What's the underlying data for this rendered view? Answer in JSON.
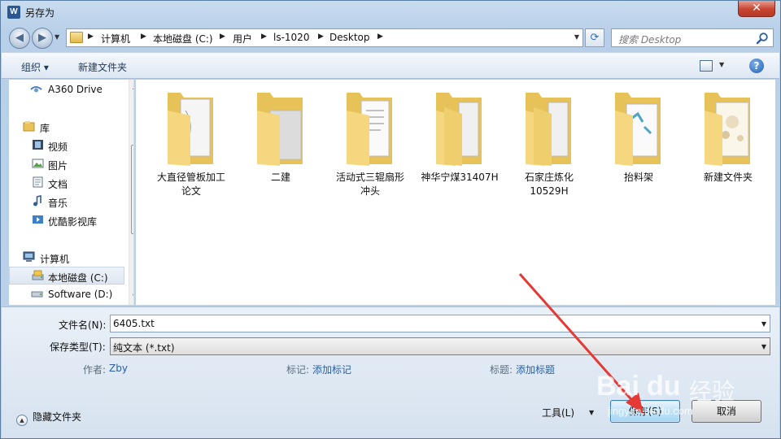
{
  "window": {
    "title": "另存为",
    "app_icon_letter": "W",
    "close_symbol": "✕"
  },
  "address": {
    "crumbs": [
      "计算机",
      "本地磁盘 (C:)",
      "用户",
      "ls-1020",
      "Desktop"
    ],
    "search_placeholder": "搜索 Desktop"
  },
  "toolbar": {
    "organize_label": "组织 ▾",
    "new_folder_label": "新建文件夹"
  },
  "navpane": {
    "items": [
      {
        "label": "A360 Drive",
        "icon": "a360-drive-icon"
      },
      {
        "label": "库",
        "icon": "library-icon"
      },
      {
        "label": "视频",
        "icon": "videos-icon"
      },
      {
        "label": "图片",
        "icon": "pictures-icon"
      },
      {
        "label": "文档",
        "icon": "documents-icon"
      },
      {
        "label": "音乐",
        "icon": "music-icon"
      },
      {
        "label": "优酷影视库",
        "icon": "youku-library-icon"
      },
      {
        "label": "计算机",
        "icon": "computer-icon"
      },
      {
        "label": "本地磁盘 (C:)",
        "icon": "local-disk-icon"
      },
      {
        "label": "Software (D:)",
        "icon": "drive-icon"
      }
    ],
    "selected": "本地磁盘 (C:)"
  },
  "files": [
    {
      "name": "大直径管板加工\n论文"
    },
    {
      "name": "二建"
    },
    {
      "name": "活动式三辊扇形\n冲头"
    },
    {
      "name": "神华宁煤31407H"
    },
    {
      "name": "石家庄炼化\n10529H"
    },
    {
      "name": "抬料架"
    },
    {
      "name": "新建文件夹"
    }
  ],
  "form": {
    "filename_label": "文件名(N):",
    "filename_value": "6405.txt",
    "filetype_label": "保存类型(T):",
    "filetype_value": "纯文本 (*.txt)",
    "author_label": "作者:",
    "author_value": "Zby",
    "tags_label": "标记:",
    "tags_value": "添加标记",
    "title_label": "标题:",
    "title_value": "添加标题"
  },
  "footer": {
    "hide_folders_label": "隐藏文件夹",
    "tools_label": "工具(L)",
    "save_label": "保存(S)",
    "cancel_label": "取消"
  },
  "watermark": {
    "brand": "Bai",
    "paw": "du",
    "text": "经验",
    "url": "jingyan.baidu.com"
  },
  "colors": {
    "arrow": "#e53935",
    "link": "#2a5fa6",
    "selection": "#dde6f0"
  }
}
